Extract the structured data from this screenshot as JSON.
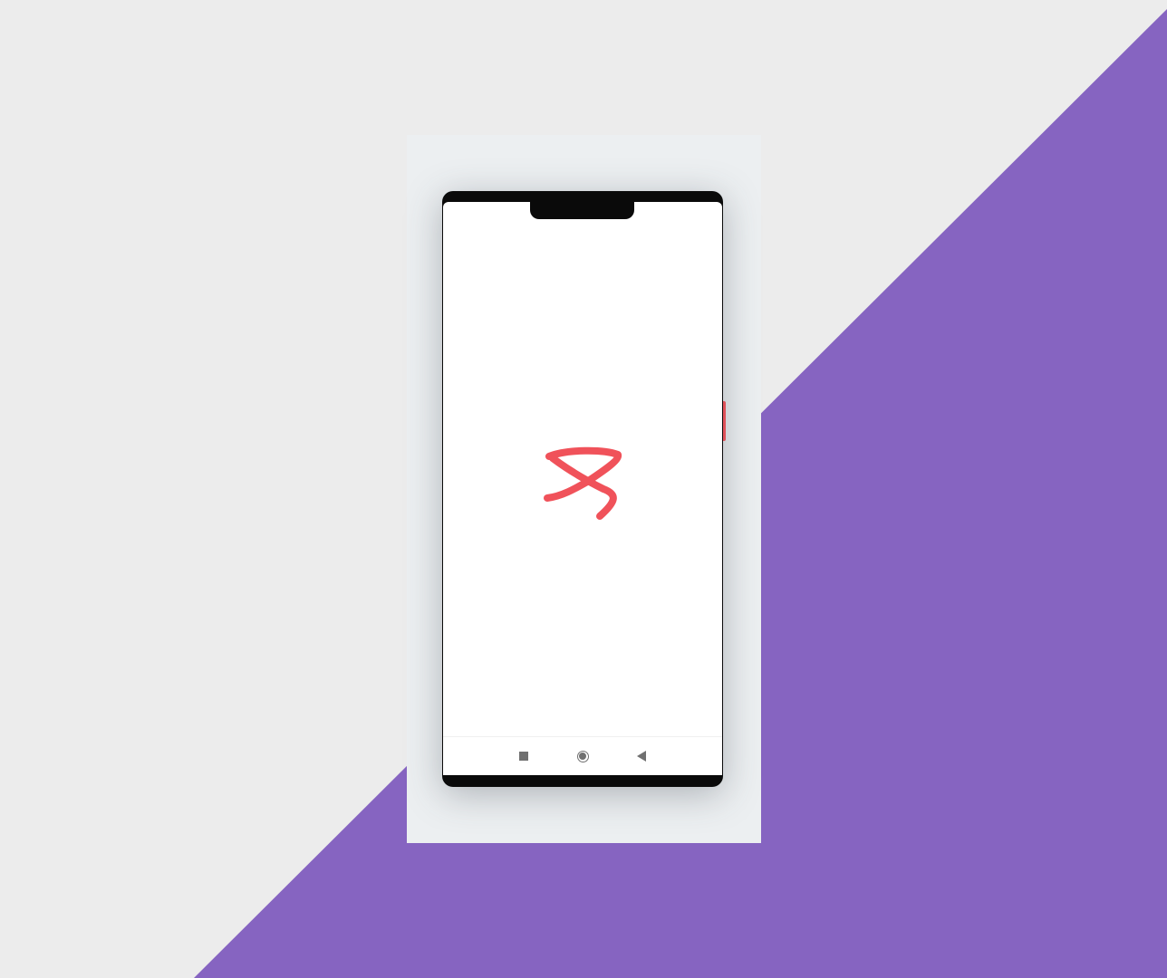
{
  "background": {
    "base_color": "#ececec",
    "accent_color": "#8664c1"
  },
  "device": {
    "panel_color": "#eceff1",
    "frame_color": "#0a0a0a",
    "screen_color": "#ffffff",
    "side_button_color": "#e0525a"
  },
  "splash": {
    "logo_icon": "app-logo-ribbon-icon",
    "logo_color": "#f0525a"
  },
  "nav_bar": {
    "buttons": [
      {
        "name": "recents-button",
        "icon": "square-icon"
      },
      {
        "name": "home-button",
        "icon": "circle-icon"
      },
      {
        "name": "back-button",
        "icon": "triangle-back-icon"
      }
    ],
    "icon_color": "#707070"
  }
}
